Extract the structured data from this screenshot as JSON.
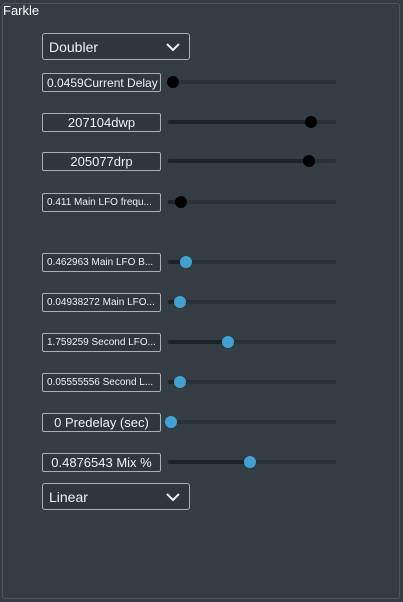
{
  "window": {
    "title": "Farkle"
  },
  "mode_combo": {
    "value": "Doubler"
  },
  "interp_combo": {
    "value": "Linear"
  },
  "params": [
    {
      "label": "0.0459Current Delay",
      "value": 0.03,
      "thumb_color": "#000000"
    },
    {
      "label": "207104dwp",
      "value": 0.85,
      "thumb_color": "#000000"
    },
    {
      "label": "205077drp",
      "value": 0.84,
      "thumb_color": "#000000"
    },
    {
      "label": "0.411 Main LFO frequ...",
      "value": 0.08,
      "thumb_color": "#000000"
    },
    {
      "label": "0.462963 Main LFO B...",
      "value": 0.11,
      "thumb_color": "#42a1d0"
    },
    {
      "label": "0.04938272 Main LFO...",
      "value": 0.07,
      "thumb_color": "#42a1d0"
    },
    {
      "label": "1.759259 Second LFO...",
      "value": 0.36,
      "thumb_color": "#42a1d0"
    },
    {
      "label": "0.05555556 Second L...",
      "value": 0.07,
      "thumb_color": "#42a1d0"
    },
    {
      "label": "0 Predelay (sec)",
      "value": 0.02,
      "thumb_color": "#42a1d0"
    },
    {
      "label": "0.4876543 Mix %",
      "value": 0.49,
      "thumb_color": "#42a1d0"
    }
  ],
  "colors": {
    "background": "#333d43",
    "field_bg": "#2d373d",
    "field_border": "#a7b0b5",
    "accent": "#42a1d0"
  }
}
